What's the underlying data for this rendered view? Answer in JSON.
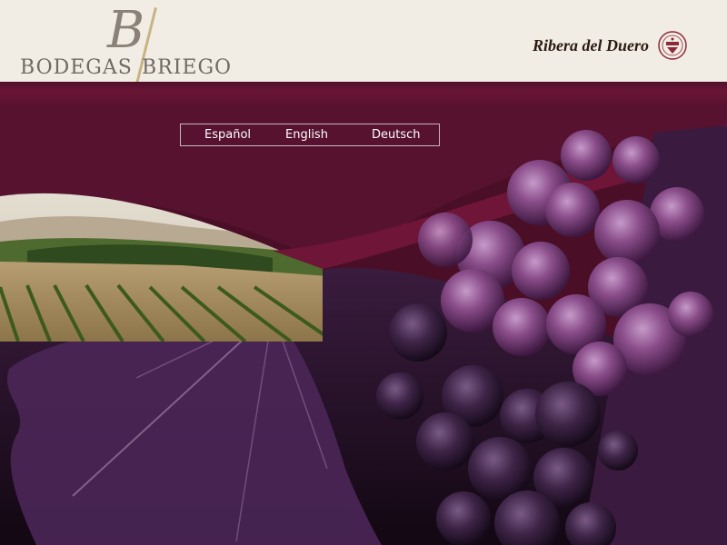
{
  "brand": {
    "logo_mark": "B",
    "name_left": "BODEGAS",
    "name_right": "BRIEGO",
    "colors": {
      "cream": "#f2ede4",
      "burgundy": "#6b1535",
      "grape_purple": "#7a3a78",
      "gold": "#c8b483"
    }
  },
  "denomination": {
    "label": "Ribera del Duero",
    "seal_icon": "ribera-del-duero-seal-icon"
  },
  "languages": [
    {
      "label": "Español"
    },
    {
      "label": "English"
    },
    {
      "label": "Deutsch"
    }
  ],
  "imagery": {
    "left_photo": "vineyard-landscape",
    "right_photo": "grape-cluster",
    "bottom_photo": "vine-leaf"
  }
}
